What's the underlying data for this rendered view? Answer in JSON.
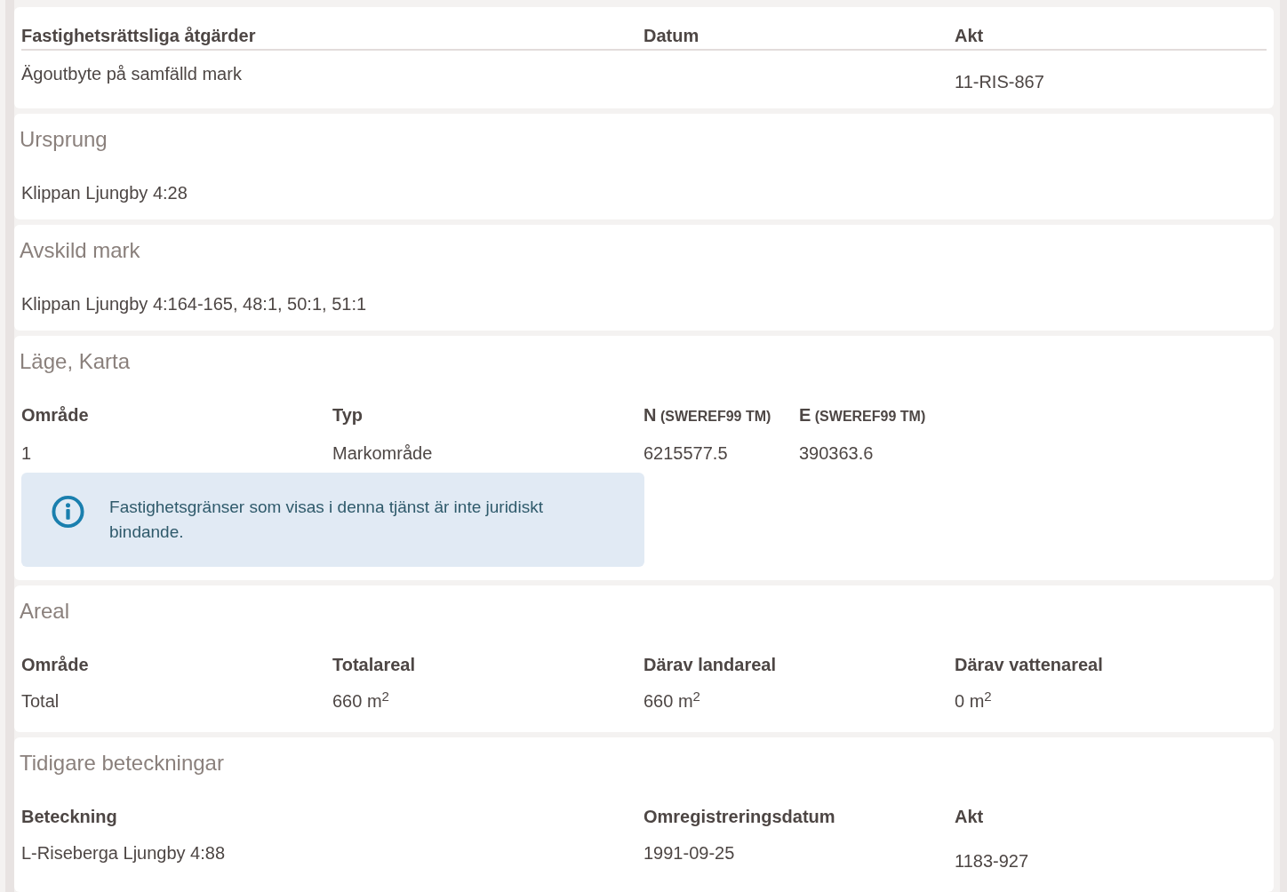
{
  "sections": [
    {
      "kind": "actions",
      "columns": [
        {
          "label": "Fastighetsrättsliga åtgärder"
        },
        {
          "label": "Datum"
        },
        {
          "label": "Akt"
        }
      ],
      "rows": [
        [
          "Ägoutbyte på samfälld mark",
          "",
          "11-RIS-867"
        ]
      ]
    },
    {
      "kind": "list",
      "title": "Ursprung",
      "lines": [
        "Klippan Ljungby 4:28"
      ]
    },
    {
      "kind": "list",
      "title": "Avskild mark",
      "lines": [
        "Klippan Ljungby 4:164-165, 48:1, 50:1, 51:1"
      ]
    },
    {
      "kind": "coords",
      "title": "Läge, Karta",
      "columns": [
        {
          "label": "Område"
        },
        {
          "label": "Typ"
        },
        {
          "label": "N",
          "unit": "(SWEREF99 TM)"
        },
        {
          "label": "E",
          "unit": "(SWEREF99 TM)"
        }
      ],
      "rows": [
        [
          "1",
          "Markområde",
          "6215577.5",
          "390363.6"
        ]
      ],
      "notice": {
        "text": "Fastighetsgränser som visas i denna tjänst är inte juridiskt bindande."
      }
    },
    {
      "kind": "area",
      "title": "Areal",
      "columns": [
        {
          "label": "Område"
        },
        {
          "label": "Totalareal"
        },
        {
          "label": "Därav landareal"
        },
        {
          "label": "Därav vattenareal"
        }
      ],
      "rows": [
        [
          "Total",
          "660 m$^{2}$",
          "660 m$^{2}$",
          "0 m$^{2}$"
        ]
      ]
    },
    {
      "kind": "names",
      "title": "Tidigare beteckningar",
      "columns": [
        {
          "label": "Beteckning"
        },
        {
          "label": "Omregistreringsdatum"
        },
        {
          "label": "Akt"
        }
      ],
      "rows": [
        [
          "L-Riseberga Ljungby 4:88",
          "1991-09-25",
          "1183-927"
        ]
      ]
    }
  ]
}
